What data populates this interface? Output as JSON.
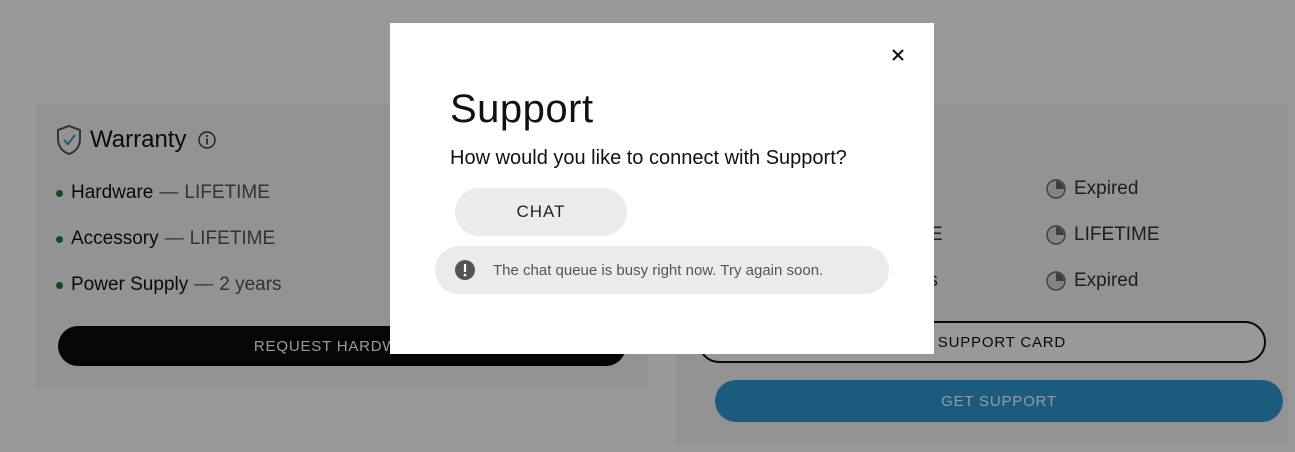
{
  "warranty": {
    "title": "Warranty",
    "icons": {
      "shield": "shield-check-icon",
      "info": "info-icon"
    },
    "items": [
      {
        "name": "Hardware",
        "sep": "—",
        "duration": "LIFETIME"
      },
      {
        "name": "Accessory",
        "sep": "—",
        "duration": "LIFETIME"
      },
      {
        "name": "Power Supply",
        "sep": "—",
        "duration": "2 years"
      }
    ],
    "request_button": "REQUEST HARDWARE",
    "bullet_color": "#1e7d32"
  },
  "support_card": {
    "rows": [
      {
        "partial": "nths",
        "status": "Expired"
      },
      {
        "partial": "ME",
        "status": "LIFETIME"
      },
      {
        "partial": "nths",
        "status": "Expired"
      }
    ],
    "outline_button": "TE A SUPPORT CARD",
    "get_support_button": "GET SUPPORT",
    "accent_color": "#2e9ad3"
  },
  "modal": {
    "title": "Support",
    "subtitle": "How would you like to connect with Support?",
    "chat_button": "CHAT",
    "notice": "The chat queue is busy right now. Try again soon.",
    "close_icon": "close-icon",
    "alert_icon": "alert-circle-icon"
  }
}
